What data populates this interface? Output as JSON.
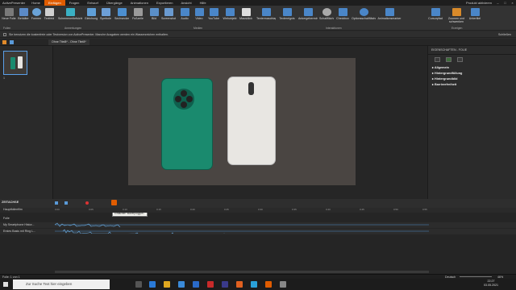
{
  "menubar": {
    "app": "ActivePresenter",
    "tabs": [
      "Home",
      "Einfügen",
      "Fragen",
      "Entwurf",
      "Übergänge",
      "Animationen",
      "Exportieren",
      "Ansicht",
      "Hilfe"
    ],
    "active_tab": "Einfügen",
    "right_text": "Produkt aktivieren"
  },
  "ribbon": {
    "buttons": [
      "Neue Folie",
      "Behälter",
      "Formen",
      "Textfeld",
      "Schemenertiefsicht",
      "Gleichung",
      "Symbole",
      "Sechsecken",
      "Fußzeile",
      "Bild",
      "Screenshot",
      "Audio",
      "Video",
      "YouTube",
      "Webobjekt",
      "Mausklick",
      "Textermaschtag",
      "Textereignis",
      "Ankergeberecht",
      "Schaltfläche",
      "Checkbox",
      "Optionsschaltfläche",
      "Animationsmarker",
      "Cursorpfad",
      "Zoomen und schwenken",
      "Untertitel"
    ],
    "groups": [
      "Folien",
      "Anmerkungen",
      "Medien",
      "Interaktionen",
      "Erzeigen"
    ]
  },
  "infobar": {
    "text": "Sie benutzen die kostenfreie oder Testversion von ActivePresenter. Manche Ausgaben werden ein Wasserzeichen enthalten.",
    "close": "Schließen"
  },
  "tabbar": {
    "title": "Ohne Titel8* - Ohne Titel8*"
  },
  "filmstrip": {
    "slide_num": "1"
  },
  "proppanel": {
    "header": "EIGENSCHAFTEN - FOLIE",
    "sections": [
      "Allgemein",
      "Hintergrundfüllung",
      "Hintergrundbild",
      "Barrierefreiheit"
    ]
  },
  "timeline": {
    "title": "ZEITACHSE",
    "layer": "Hauptfolienfilm",
    "tracks": [
      "Folie",
      "My Smartphone Histor...",
      "Erstes Basis mit Ring L..."
    ],
    "times": [
      "0:00",
      "0:05",
      "0:10",
      "0:15",
      "0:20",
      "0:25",
      "0:30",
      "0:35",
      "0:40",
      "0:45",
      "0:50",
      "0:55"
    ],
    "tooltip": "Einfachen Nutzerpolygon..."
  },
  "statusbar": {
    "left": "Folie: 1 von 1",
    "lang": "Deutsch",
    "zoom": "46%"
  },
  "taskbar": {
    "search": "Zur Suche Text hier eingeben",
    "time": "22:27",
    "date": "03.05.2021"
  },
  "colors": {
    "accent": "#e05c00",
    "phone_green": "#1a8a6e",
    "phone_white": "#e8e6e2"
  }
}
